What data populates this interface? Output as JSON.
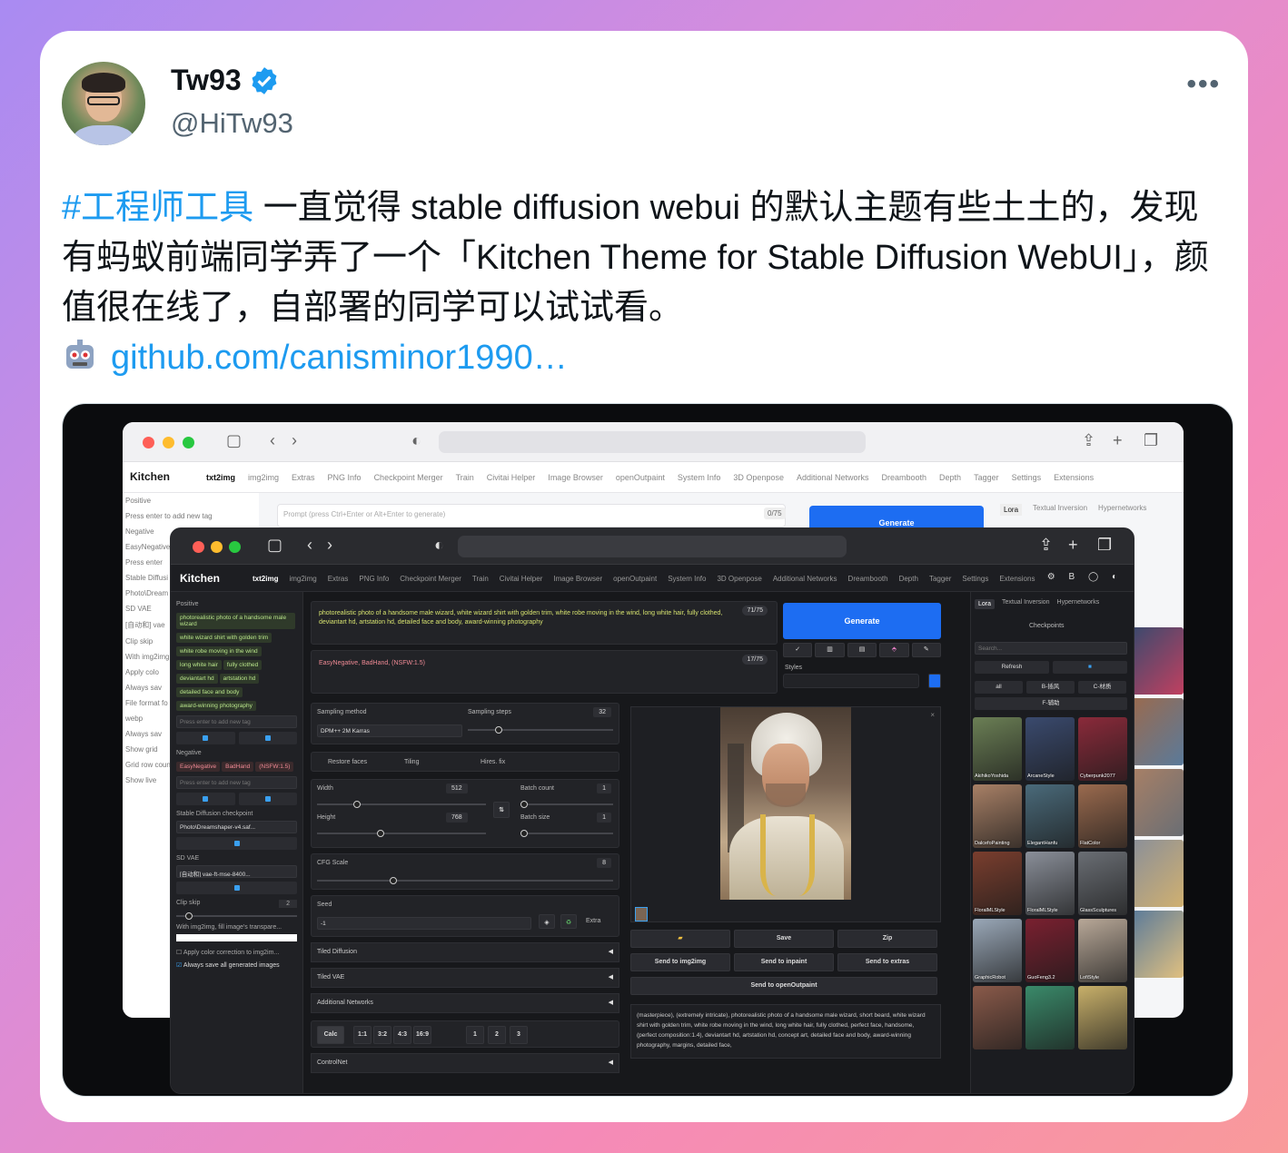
{
  "tweet": {
    "author_name": "Tw93",
    "handle": "@HiTw93",
    "more_label": "•••",
    "hashtag": "#工程师工具",
    "body": " 一直觉得 stable diffusion webui 的默认主题有些土土的，发现有蚂蚁前端同学弄了一个「Kitchen Theme for Stable Diffusion WebUI」，颜值很在线了，自部署的同学可以试试看。",
    "link_text": "github.com/canisminor1990…",
    "accent_color": "#1d9bf0"
  },
  "back_window": {
    "brand": "Kitchen",
    "tabs": [
      "txt2img",
      "img2img",
      "Extras",
      "PNG Info",
      "Checkpoint Merger",
      "Train",
      "Civitai Helper",
      "Image Browser",
      "openOutpaint",
      "System Info",
      "3D Openpose",
      "Additional Networks",
      "Dreambooth",
      "Depth",
      "Tagger",
      "Settings",
      "Extensions"
    ],
    "side_labels": [
      "Positive",
      "Press enter to add new tag",
      "Negative",
      "EasyNegative",
      "Press enter",
      "Stable Diffusi",
      "Photo\\Dream",
      "SD VAE",
      "[自动和] vae",
      "Clip skip",
      "With img2img",
      "Apply colo",
      "Always sav",
      "File format fo",
      "webp",
      "Always sav",
      "Show grid",
      "Grid row coun",
      "Show live"
    ],
    "prompt_placeholder": "Prompt (press Ctrl+Enter or Alt+Enter to generate)",
    "count": "0/75",
    "generate_label": "Generate",
    "right_tabs": [
      "Lora",
      "Textual Inversion",
      "Hypernetworks"
    ]
  },
  "front_window": {
    "brand": "Kitchen",
    "tabs": [
      "txt2img",
      "img2img",
      "Extras",
      "PNG Info",
      "Checkpoint Merger",
      "Train",
      "Civitai Helper",
      "Image Browser",
      "openOutpaint",
      "System Info",
      "3D Openpose",
      "Additional Networks",
      "Dreambooth",
      "Depth",
      "Tagger",
      "Settings",
      "Extensions"
    ],
    "header_icons": "⚙ B ◯ ◐",
    "sidebar": {
      "positive_label": "Positive",
      "positive_tags": [
        "photorealistic photo of a handsome male wizard",
        "white wizard shirt with golden trim",
        "white robe moving in the wind",
        "long white hair",
        "fully clothed",
        "deviantart hd",
        "artstation hd",
        "detailed face and body",
        "award-winning photography"
      ],
      "add_tag_placeholder": "Press enter to add new tag",
      "negative_label": "Negative",
      "negative_tags": [
        "EasyNegative",
        "BadHand",
        "(NSFW:1.5)"
      ],
      "checkpoint_label": "Stable Diffusion checkpoint",
      "checkpoint_value": "Photo\\Dreamshaper-v4.saf...",
      "vae_label": "SD VAE",
      "vae_value": "[自动和] vae-ft-mse-8400...",
      "clip_label": "Clip skip",
      "clip_value": "2",
      "img2img_note": "With img2img, fill image's transpare...",
      "opt1": "Apply color correction to img2im...",
      "opt2": "Always save all generated images"
    },
    "prompt": {
      "positive_text": "photorealistic photo of a handsome male wizard, white wizard shirt with golden trim, white robe moving in the wind, long white hair, fully clothed, deviantart hd, artstation hd, detailed face and body, award-winning photography",
      "positive_count": "71/75",
      "negative_text": "EasyNegative, BadHand, (NSFW:1.5)",
      "negative_count": "17/75",
      "generate_label": "Generate",
      "styles_label": "Styles"
    },
    "params": {
      "sampling_method_label": "Sampling method",
      "sampling_method_value": "DPM++ 2M Karras",
      "sampling_steps_label": "Sampling steps",
      "sampling_steps_value": "32",
      "restore_faces": "Restore faces",
      "tiling": "Tiling",
      "hires": "Hires. fix",
      "width_label": "Width",
      "width_value": "512",
      "height_label": "Height",
      "height_value": "768",
      "batch_count_label": "Batch count",
      "batch_count_value": "1",
      "batch_size_label": "Batch size",
      "batch_size_value": "1",
      "cfg_label": "CFG Scale",
      "cfg_value": "8",
      "seed_label": "Seed",
      "seed_value": "-1",
      "extra_label": "Extra",
      "accordions": [
        "Tiled Diffusion",
        "Tiled VAE",
        "Additional Networks"
      ],
      "calc_label": "Calc",
      "ratios": [
        "1:1",
        "3:2",
        "4:3",
        "16:9"
      ],
      "multipliers": [
        "1",
        "2",
        "3"
      ],
      "controlnet_label": "ControlNet"
    },
    "output": {
      "save": "Save",
      "zip": "Zip",
      "send_img2img": "Send to img2img",
      "send_inpaint": "Send to inpaint",
      "send_extras": "Send to extras",
      "send_outpaint": "Send to openOutpaint",
      "info_text": "(masterpiece), (extremely intricate), photorealistic photo of a handsome male wizard, short beard, white wizard shirt with golden trim, white robe moving in the wind, long white hair, fully clothed, perfect face, handsome, (perfect composition:1.4), deviantart hd, artstation hd, concept art, detailed face and body, award-winning photography, margins, detailed face,"
    },
    "right_panel": {
      "tabs": [
        "Lora",
        "Textual Inversion",
        "Hypernetworks"
      ],
      "checkpoints_label": "Checkpoints",
      "search_placeholder": "Search...",
      "refresh_label": "Refresh",
      "filters": [
        "all",
        "B-插风",
        "C-材质",
        "F-辅助"
      ],
      "thumbs": [
        {
          "label": "AkihikoYoshida",
          "color": "#6b7f55"
        },
        {
          "label": "ArcaneStyle",
          "color": "#3a4a6e"
        },
        {
          "label": "Cyberpunk2077",
          "color": "#8a2a3a"
        },
        {
          "label": "DalcefoPainting",
          "color": "#a88066"
        },
        {
          "label": "ElegantHanfu",
          "color": "#4a6a7a"
        },
        {
          "label": "FlatColor",
          "color": "#9a6a4e"
        },
        {
          "label": "FloralMLStyle",
          "color": "#7a3e2e"
        },
        {
          "label": "FloralMLStyle",
          "color": "#8a8f99"
        },
        {
          "label": "GlassSculptures",
          "color": "#6a6e74"
        },
        {
          "label": "GraphicRobot",
          "color": "#9aa8b8"
        },
        {
          "label": "GuoFeng3.2",
          "color": "#7a2030"
        },
        {
          "label": "LofiStyle",
          "color": "#b8a898"
        },
        {
          "label": "",
          "color": "#8a5a4a"
        },
        {
          "label": "",
          "color": "#3a8a6a"
        },
        {
          "label": "",
          "color": "#c8b06a"
        }
      ]
    }
  }
}
